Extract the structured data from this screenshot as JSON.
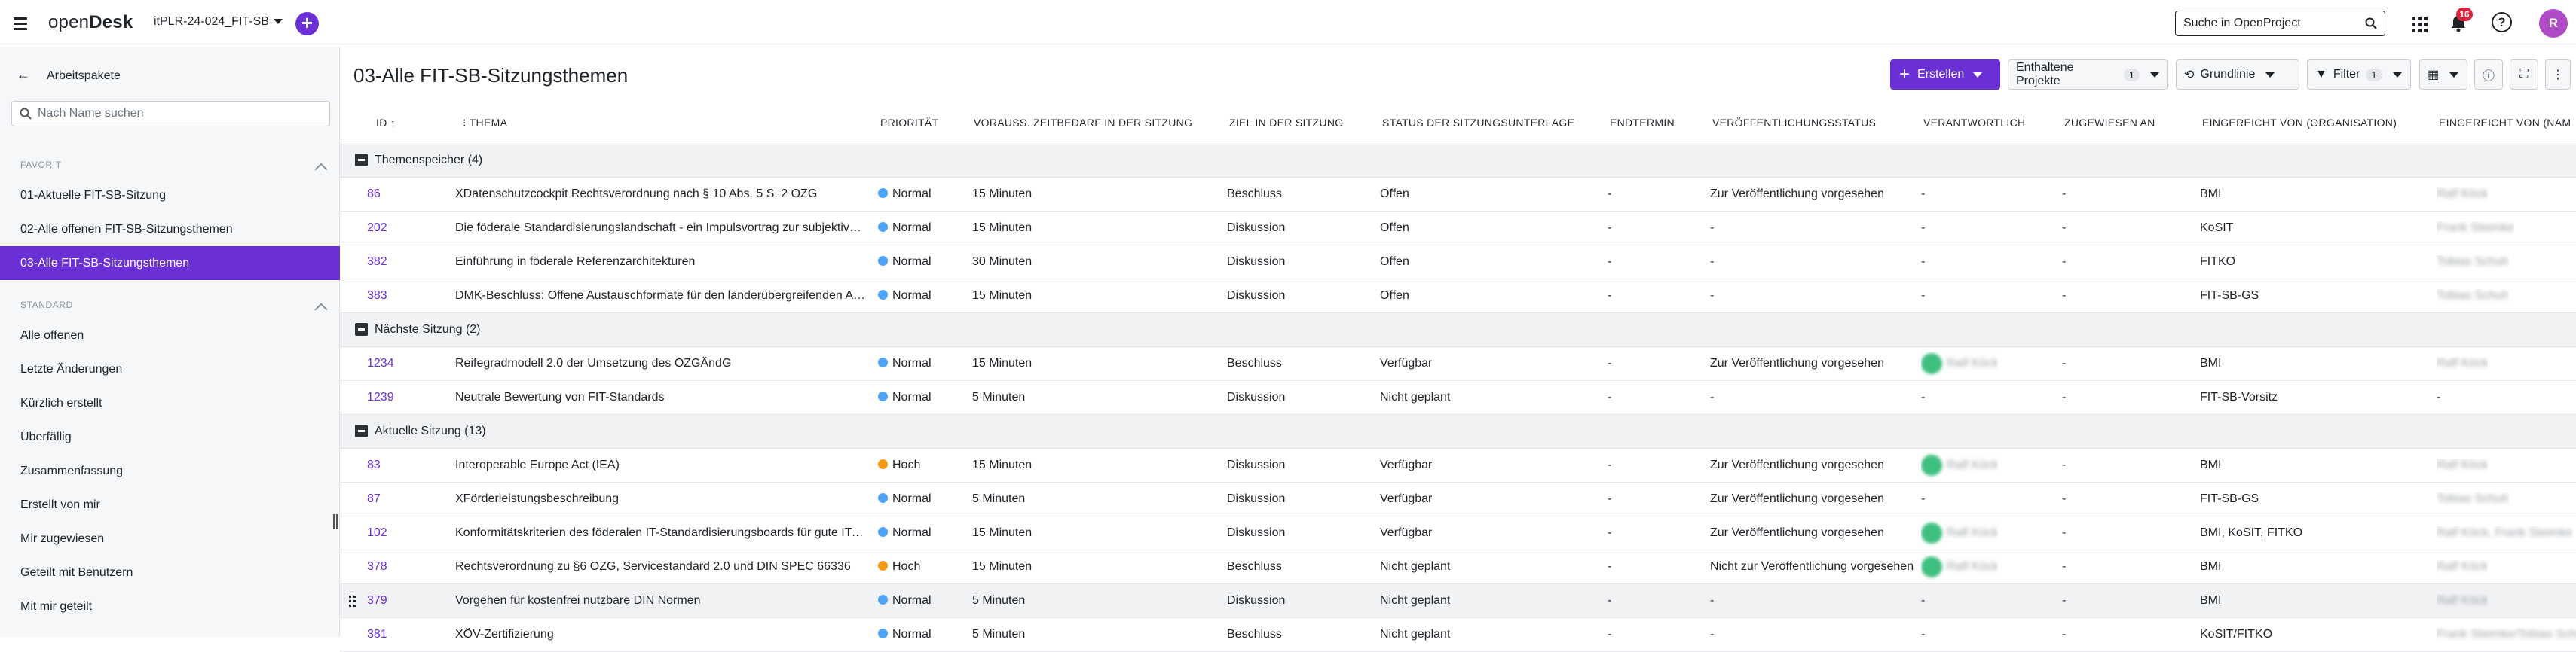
{
  "header": {
    "logo": {
      "prefix": "open",
      "suffix": "Desk"
    },
    "project": "itPLR-24-024_FIT-SB",
    "search_placeholder": "Suche in OpenProject",
    "notification_count": "16",
    "help_glyph": "?",
    "avatar_initials": "R"
  },
  "sidebar": {
    "back_label": "Arbeitspakete",
    "search_placeholder": "Nach Name suchen",
    "sections": [
      {
        "title": "FAVORIT",
        "items": [
          "01-Aktuelle FIT-SB-Sitzung",
          "02-Alle offenen FIT-SB-Sitzungsthemen",
          "03-Alle FIT-SB-Sitzungsthemen"
        ]
      },
      {
        "title": "STANDARD",
        "items": [
          "Alle offenen",
          "Letzte Änderungen",
          "Kürzlich erstellt",
          "Überfällig",
          "Zusammenfassung",
          "Erstellt von mir",
          "Mir zugewiesen",
          "Geteilt mit Benutzern",
          "Mit mir geteilt"
        ]
      }
    ],
    "active_item": "03-Alle FIT-SB-Sitzungsthemen"
  },
  "main": {
    "title": "03-Alle FIT-SB-Sitzungsthemen",
    "toolbar": {
      "create_label": "Erstellen",
      "included_projects_label": "Enthaltene Projekte",
      "included_projects_count": "1",
      "baseline_label": "Grundlinie",
      "filter_label": "Filter",
      "filter_count": "1"
    },
    "columns": {
      "id": "ID",
      "subject": "THEMA",
      "priority": "PRIORITÄT",
      "time": "VORAUSS. ZEITBEDARF IN DER SITZUNG",
      "goal": "ZIEL IN DER SITZUNG",
      "status": "STATUS DER SITZUNGSUNTERLAGE",
      "end": "ENDTERMIN",
      "publication": "VERÖFFENTLICHUNGSSTATUS",
      "responsible": "VERANTWORTLICH",
      "assigned": "ZUGEWIESEN AN",
      "org": "EINGEREICHT VON (ORGANISATION)",
      "name": "EINGEREICHT VON (NAM"
    },
    "groups": [
      {
        "label": "Themenspeicher (4)",
        "rows": [
          {
            "id": "86",
            "subject": "XDatenschutzcockpit Rechtsverordnung nach § 10 Abs. 5 S. 2 OZG",
            "priority": "Normal",
            "time": "15 Minuten",
            "goal": "Beschluss",
            "status": "Offen",
            "end": "-",
            "publication": "Zur Veröffentlichung vorgesehen",
            "responsible": "-",
            "assigned": "-",
            "org": "BMI",
            "name": "Ralf Köck"
          },
          {
            "id": "202",
            "subject": "Die föderale Standardisierungslandschaft - ein Impulsvortrag zur subjektiven Einordnung",
            "priority": "Normal",
            "time": "15 Minuten",
            "goal": "Diskussion",
            "status": "Offen",
            "end": "-",
            "publication": "-",
            "responsible": "-",
            "assigned": "-",
            "org": "KoSIT",
            "name": "Frank Steimke"
          },
          {
            "id": "382",
            "subject": "Einführung in föderale Referenzarchitekturen",
            "priority": "Normal",
            "time": "30 Minuten",
            "goal": "Diskussion",
            "status": "Offen",
            "end": "-",
            "publication": "-",
            "responsible": "-",
            "assigned": "-",
            "org": "FITKO",
            "name": "Tobias Schuh"
          },
          {
            "id": "383",
            "subject": "DMK-Beschluss: Offene Austauschformate für den länderübergreifenden Austausch",
            "priority": "Normal",
            "time": "15 Minuten",
            "goal": "Diskussion",
            "status": "Offen",
            "end": "-",
            "publication": "-",
            "responsible": "-",
            "assigned": "-",
            "org": "FIT-SB-GS",
            "name": "Tobias Schuh"
          }
        ]
      },
      {
        "label": "Nächste Sitzung (2)",
        "rows": [
          {
            "id": "1234",
            "subject": "Reifegradmodell 2.0 der Umsetzung des OZGÄndG",
            "priority": "Normal",
            "time": "15 Minuten",
            "goal": "Beschluss",
            "status": "Verfügbar",
            "end": "-",
            "publication": "Zur Veröffentlichung vorgesehen",
            "responsible": "Ralf Köck",
            "assigned": "-",
            "org": "BMI",
            "name": "Ralf Köck"
          },
          {
            "id": "1239",
            "subject": "Neutrale Bewertung von FIT-Standards",
            "priority": "Normal",
            "time": "5 Minuten",
            "goal": "Diskussion",
            "status": "Nicht geplant",
            "end": "-",
            "publication": "-",
            "responsible": "-",
            "assigned": "-",
            "org": "FIT-SB-Vorsitz",
            "name": "-"
          }
        ]
      },
      {
        "label": "Aktuelle Sitzung (13)",
        "rows": [
          {
            "id": "83",
            "subject": "Interoperable Europe Act (IEA)",
            "priority": "Hoch",
            "time": "15 Minuten",
            "goal": "Diskussion",
            "status": "Verfügbar",
            "end": "-",
            "publication": "Zur Veröffentlichung vorgesehen",
            "responsible": "Ralf Köck",
            "assigned": "-",
            "org": "BMI",
            "name": "Ralf Köck"
          },
          {
            "id": "87",
            "subject": "XFörderleistungsbeschreibung",
            "priority": "Normal",
            "time": "5 Minuten",
            "goal": "Diskussion",
            "status": "Verfügbar",
            "end": "-",
            "publication": "Zur Veröffentlichung vorgesehen",
            "responsible": "-",
            "assigned": "-",
            "org": "FIT-SB-GS",
            "name": "Tobias Schuh"
          },
          {
            "id": "102",
            "subject": "Konformitätskriterien des föderalen IT-Standardisierungsboards für gute IT-Standards",
            "priority": "Normal",
            "time": "15 Minuten",
            "goal": "Diskussion",
            "status": "Verfügbar",
            "end": "-",
            "publication": "Zur Veröffentlichung vorgesehen",
            "responsible": "Ralf Köck",
            "assigned": "-",
            "org": "BMI, KoSIT, FITKO",
            "name": "Ralf Köck, Frank Steimke"
          },
          {
            "id": "378",
            "subject": "Rechtsverordnung zu §6 OZG, Servicestandard 2.0 und DIN SPEC 66336",
            "priority": "Hoch",
            "time": "15 Minuten",
            "goal": "Beschluss",
            "status": "Nicht geplant",
            "end": "-",
            "publication": "Nicht zur Veröffentlichung vorgesehen",
            "responsible": "Ralf Köck",
            "assigned": "-",
            "org": "BMI",
            "name": "Ralf Köck"
          },
          {
            "id": "379",
            "subject": "Vorgehen für kostenfrei nutzbare DIN Normen",
            "priority": "Normal",
            "time": "5 Minuten",
            "goal": "Diskussion",
            "status": "Nicht geplant",
            "end": "-",
            "publication": "-",
            "responsible": "-",
            "assigned": "-",
            "org": "BMI",
            "name": "Ralf Köck"
          },
          {
            "id": "381",
            "subject": "XÖV-Zertifizierung",
            "priority": "Normal",
            "time": "5 Minuten",
            "goal": "Beschluss",
            "status": "Nicht geplant",
            "end": "-",
            "publication": "-",
            "responsible": "-",
            "assigned": "-",
            "org": "KoSIT/FITKO",
            "name": "Frank Steimke/Tobias Schuh"
          }
        ]
      }
    ]
  },
  "colors": {
    "accent": "#6b2fd6",
    "prio_normal": "#4fa3f7",
    "prio_high": "#f39c12",
    "badge": "#d9213a"
  }
}
